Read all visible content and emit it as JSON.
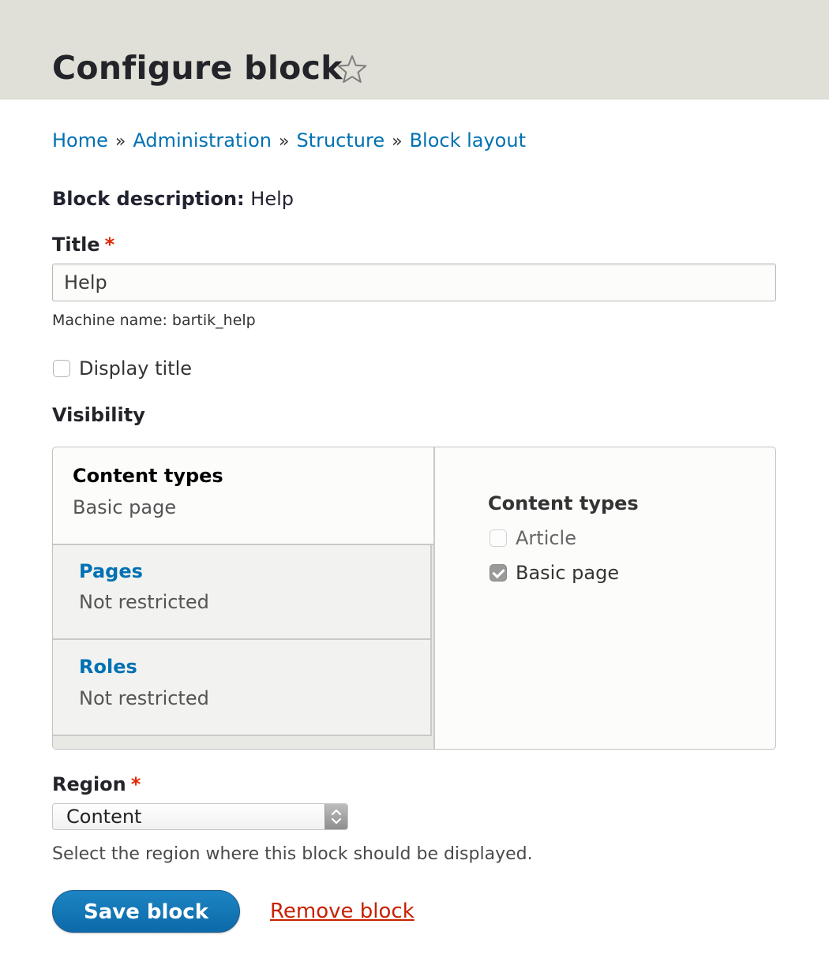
{
  "page": {
    "title": "Configure block"
  },
  "breadcrumb": {
    "items": [
      "Home",
      "Administration",
      "Structure",
      "Block layout"
    ],
    "separator": "»"
  },
  "block_description": {
    "label": "Block description:",
    "value": "Help"
  },
  "title_field": {
    "label": "Title",
    "required_marker": "*",
    "value": "Help",
    "machine_name_label": "Machine name:",
    "machine_name_value": "bartik_help"
  },
  "display_title": {
    "label": "Display title",
    "checked": false
  },
  "visibility": {
    "heading": "Visibility",
    "tabs": [
      {
        "title": "Content types",
        "summary": "Basic page",
        "selected": true
      },
      {
        "title": "Pages",
        "summary": "Not restricted",
        "selected": false
      },
      {
        "title": "Roles",
        "summary": "Not restricted",
        "selected": false
      }
    ],
    "pane": {
      "heading": "Content types",
      "options": [
        {
          "label": "Article",
          "checked": false
        },
        {
          "label": "Basic page",
          "checked": true
        }
      ]
    }
  },
  "region": {
    "label": "Region",
    "required_marker": "*",
    "selected": "Content",
    "help": "Select the region where this block should be displayed."
  },
  "actions": {
    "save_label": "Save block",
    "remove_label": "Remove block"
  },
  "colors": {
    "link": "#0071b3",
    "required": "#e32700",
    "primary_button": "#0c74b8",
    "danger_link": "#c72100",
    "header_bg": "#e0e0d8"
  }
}
